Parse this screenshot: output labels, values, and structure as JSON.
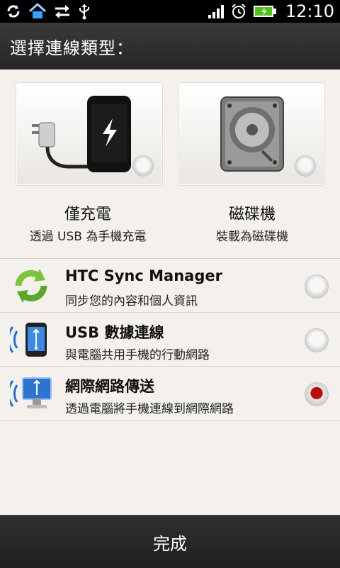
{
  "status_bar": {
    "time": "12:10",
    "left_icons": [
      "sync-icon",
      "home-icon",
      "data-transfer-icon",
      "usb-icon"
    ],
    "right_icons": [
      "signal-icon",
      "alarm-icon",
      "battery-charging-icon"
    ]
  },
  "header": {
    "title": "選擇連線類型："
  },
  "cards": [
    {
      "title": "僅充電",
      "subtitle": "透過 USB 為手機充電",
      "selected": false,
      "icon": "charger-phone-icon"
    },
    {
      "title": "磁碟機",
      "subtitle": "裝載為磁碟機",
      "selected": false,
      "icon": "disk-drive-icon"
    }
  ],
  "options": [
    {
      "title": "HTC Sync Manager",
      "subtitle": "同步您的內容和個人資訊",
      "selected": false,
      "icon": "sync-arrows-icon"
    },
    {
      "title": "USB 數據連線",
      "subtitle": "與電腦共用手機的行動網路",
      "selected": false,
      "icon": "usb-tether-icon"
    },
    {
      "title": "網際網路傳送",
      "subtitle": "透過電腦將手機連線到網際網路",
      "selected": true,
      "icon": "internet-pass-through-icon"
    }
  ],
  "footer": {
    "done_label": "完成"
  },
  "colors": {
    "selected_radio": "#b80d0d",
    "header_bg": "#2e2e2e",
    "content_bg": "#f4f1ec"
  }
}
